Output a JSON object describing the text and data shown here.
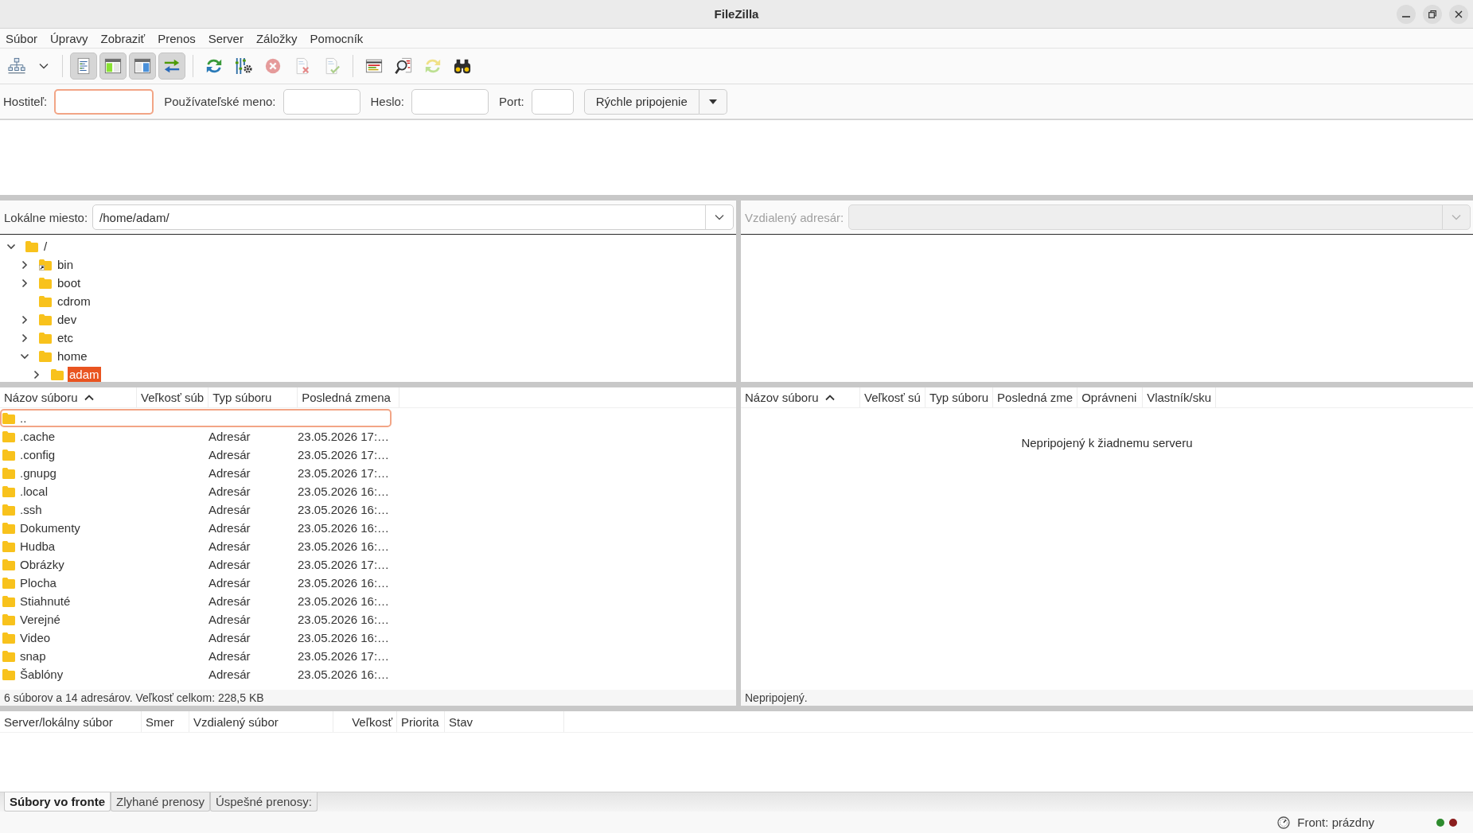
{
  "window": {
    "title": "FileZilla"
  },
  "menu": [
    "Súbor",
    "Úpravy",
    "Zobraziť",
    "Prenos",
    "Server",
    "Záložky",
    "Pomocník"
  ],
  "toolbar": {
    "groups": [
      [
        {
          "pressed": false,
          "disabled": false
        },
        {
          "pressed": false,
          "disabled": false
        }
      ],
      [
        {
          "pressed": true,
          "disabled": false
        },
        {
          "pressed": true,
          "disabled": false
        },
        {
          "pressed": true,
          "disabled": false
        },
        {
          "pressed": true,
          "disabled": false
        }
      ],
      [
        {
          "pressed": false,
          "disabled": false
        },
        {
          "pressed": false,
          "disabled": false
        },
        {
          "pressed": false,
          "disabled": true
        },
        {
          "pressed": false,
          "disabled": true
        },
        {
          "pressed": false,
          "disabled": true
        }
      ],
      [
        {
          "pressed": false,
          "disabled": false
        },
        {
          "pressed": false,
          "disabled": false
        },
        {
          "pressed": false,
          "disabled": true
        },
        {
          "pressed": false,
          "disabled": false
        }
      ]
    ]
  },
  "quickconnect": {
    "fields": [
      {
        "label": "Hostiteľ:",
        "focused": true
      },
      {
        "label": "Používateľské meno:",
        "focused": false
      },
      {
        "label": "Heslo:",
        "focused": false
      },
      {
        "label": "Port:",
        "focused": false
      }
    ],
    "button": "Rýchle pripojenie"
  },
  "local": {
    "site": {
      "label": "Lokálne miesto:",
      "path": "/home/adam/",
      "disabled": false
    },
    "tree": [
      {
        "name": "/",
        "kind": "folder",
        "expandable": true,
        "expanded": true,
        "selected": false,
        "children": [
          {
            "name": "bin",
            "kind": "symlink",
            "expandable": true,
            "expanded": false,
            "selected": false
          },
          {
            "name": "boot",
            "kind": "folder",
            "expandable": true,
            "expanded": false,
            "selected": false
          },
          {
            "name": "cdrom",
            "kind": "folder",
            "expandable": false,
            "selected": false
          },
          {
            "name": "dev",
            "kind": "folder",
            "expandable": true,
            "expanded": false,
            "selected": false
          },
          {
            "name": "etc",
            "kind": "folder",
            "expandable": true,
            "expanded": false,
            "selected": false
          },
          {
            "name": "home",
            "kind": "folder",
            "expandable": true,
            "expanded": true,
            "selected": false,
            "children": [
              {
                "name": "adam",
                "kind": "folder",
                "expandable": true,
                "expanded": false,
                "selected": true
              }
            ]
          }
        ]
      }
    ],
    "columns": [
      {
        "title": "Názov súboru",
        "sorted": true
      },
      {
        "title": "Veľkosť súb",
        "sorted": false
      },
      {
        "title": "Typ súboru",
        "sorted": false
      },
      {
        "title": "Posledná zmena",
        "sorted": false
      }
    ],
    "rows": [
      {
        "name": "..",
        "selected": true
      },
      {
        "name": ".cache",
        "type": "Adresár",
        "modified": "23.05.2026 17:…",
        "selected": false
      },
      {
        "name": ".config",
        "type": "Adresár",
        "modified": "23.05.2026 17:…",
        "selected": false
      },
      {
        "name": ".gnupg",
        "type": "Adresár",
        "modified": "23.05.2026 17:…",
        "selected": false
      },
      {
        "name": ".local",
        "type": "Adresár",
        "modified": "23.05.2026 16:…",
        "selected": false
      },
      {
        "name": ".ssh",
        "type": "Adresár",
        "modified": "23.05.2026 16:…",
        "selected": false
      },
      {
        "name": "Dokumenty",
        "type": "Adresár",
        "modified": "23.05.2026 16:…",
        "selected": false
      },
      {
        "name": "Hudba",
        "type": "Adresár",
        "modified": "23.05.2026 16:…",
        "selected": false
      },
      {
        "name": "Obrázky",
        "type": "Adresár",
        "modified": "23.05.2026 17:…",
        "selected": false
      },
      {
        "name": "Plocha",
        "type": "Adresár",
        "modified": "23.05.2026 16:…",
        "selected": false
      },
      {
        "name": "Stiahnuté",
        "type": "Adresár",
        "modified": "23.05.2026 16:…",
        "selected": false
      },
      {
        "name": "Verejné",
        "type": "Adresár",
        "modified": "23.05.2026 16:…",
        "selected": false
      },
      {
        "name": "Video",
        "type": "Adresár",
        "modified": "23.05.2026 16:…",
        "selected": false
      },
      {
        "name": "snap",
        "type": "Adresár",
        "modified": "23.05.2026 17:…",
        "selected": false
      },
      {
        "name": "Šablóny",
        "type": "Adresár",
        "modified": "23.05.2026 16:…",
        "selected": false
      }
    ],
    "status": "6 súborov a 14 adresárov. Veľkosť celkom: 228,5 KB"
  },
  "remote": {
    "site": {
      "label": "Vzdialený adresár:",
      "disabled": true
    },
    "columns": [
      {
        "title": "Názov súboru",
        "sorted": true
      },
      {
        "title": "Veľkosť sú",
        "sorted": false
      },
      {
        "title": "Typ súboru",
        "sorted": false
      },
      {
        "title": "Posledná zme",
        "sorted": false
      },
      {
        "title": "Oprávneni",
        "sorted": false
      },
      {
        "title": "Vlastník/sku",
        "sorted": false
      }
    ],
    "message": "Nepripojený k žiadnemu serveru",
    "status": "Nepripojený."
  },
  "queue": {
    "columns": [
      "Server/lokálny súbor",
      "Smer",
      "Vzdialený súbor",
      "Veľkosť",
      "Priorita",
      "Stav"
    ],
    "tabs": [
      {
        "label": "Súbory vo fronte",
        "selected": true
      },
      {
        "label": "Zlyhané prenosy",
        "selected": false
      },
      {
        "label": "Úspešné prenosy:",
        "selected": false
      }
    ]
  },
  "status_bar": {
    "queue": "Front: prázdny",
    "lights": [
      {
        "color": "#2e8b2e"
      },
      {
        "color": "#8b1e1e"
      }
    ]
  }
}
